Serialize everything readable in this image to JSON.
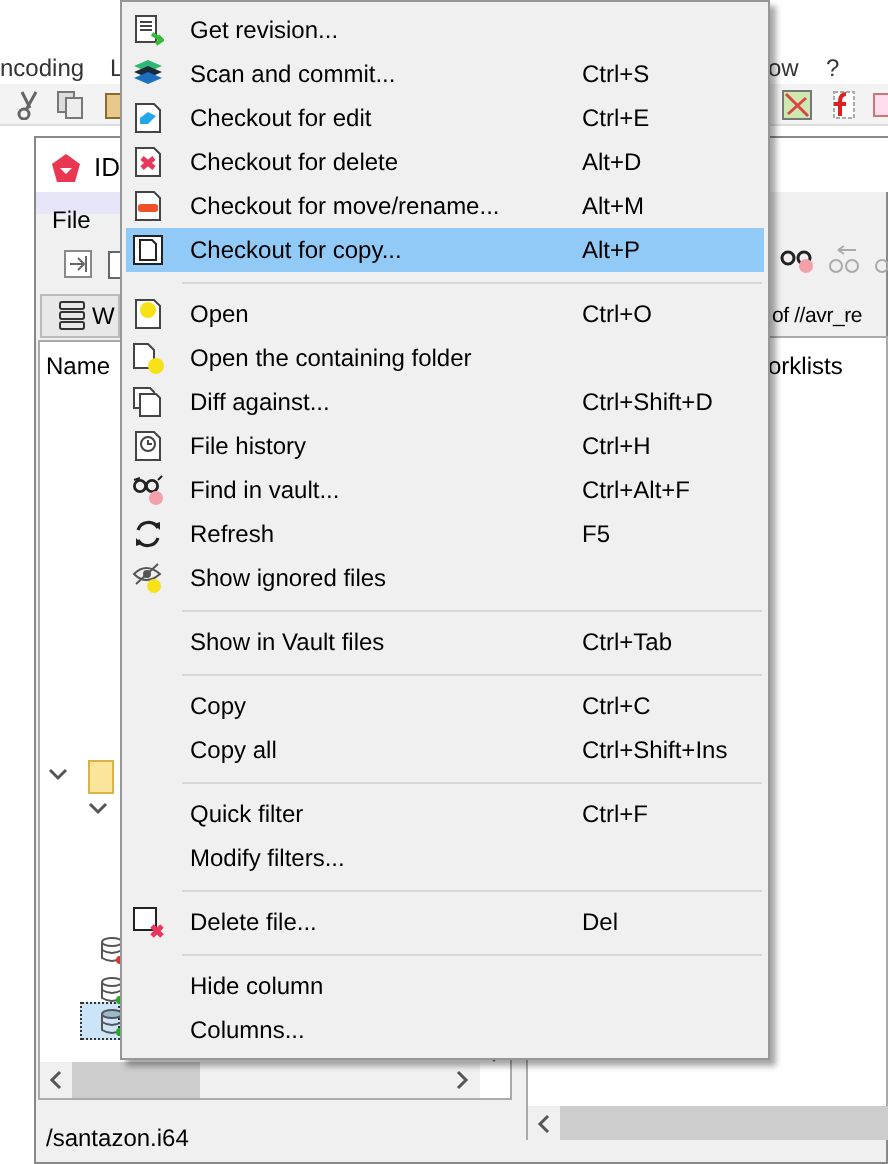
{
  "app_menu": [
    "ncoding",
    "L",
    "ow",
    "?"
  ],
  "window": {
    "title": "ID",
    "menu": [
      "File"
    ],
    "panel_button": "W",
    "panel_caption": "of //avr_re",
    "column_header": "Name",
    "right_column_header": "orklists",
    "path": "/santazon.i64"
  },
  "context_menu": [
    {
      "kind": "item",
      "label": "Get revision...",
      "selected": false
    },
    {
      "kind": "item",
      "label": "Scan and commit...",
      "shortcut": "Ctrl+S",
      "selected": false
    },
    {
      "kind": "item",
      "label": "Checkout for edit",
      "shortcut": "Ctrl+E",
      "selected": false
    },
    {
      "kind": "item",
      "label": "Checkout for delete",
      "shortcut": "Alt+D",
      "selected": false
    },
    {
      "kind": "item",
      "label": "Checkout for move/rename...",
      "shortcut": "Alt+M",
      "selected": false
    },
    {
      "kind": "item",
      "label": "Checkout for copy...",
      "shortcut": "Alt+P",
      "selected": true
    },
    {
      "kind": "separator"
    },
    {
      "kind": "item",
      "label": "Open",
      "shortcut": "Ctrl+O",
      "selected": false
    },
    {
      "kind": "item",
      "label": "Open the containing folder",
      "selected": false
    },
    {
      "kind": "item",
      "label": "Diff against...",
      "shortcut": "Ctrl+Shift+D",
      "selected": false
    },
    {
      "kind": "item",
      "label": "File history",
      "shortcut": "Ctrl+H",
      "selected": false
    },
    {
      "kind": "item",
      "label": "Find in vault...",
      "shortcut": "Ctrl+Alt+F",
      "selected": false
    },
    {
      "kind": "item",
      "label": "Refresh",
      "shortcut": "F5",
      "selected": false
    },
    {
      "kind": "item",
      "label": "Show ignored files",
      "selected": false
    },
    {
      "kind": "separator"
    },
    {
      "kind": "item",
      "label": "Show in Vault files",
      "shortcut": "Ctrl+Tab",
      "selected": false
    },
    {
      "kind": "separator"
    },
    {
      "kind": "item",
      "label": "Copy",
      "shortcut": "Ctrl+C",
      "selected": false
    },
    {
      "kind": "item",
      "label": "Copy all",
      "shortcut": "Ctrl+Shift+Ins",
      "selected": false
    },
    {
      "kind": "separator"
    },
    {
      "kind": "item",
      "label": "Quick filter",
      "shortcut": "Ctrl+F",
      "selected": false
    },
    {
      "kind": "item",
      "label": "Modify filters...",
      "selected": false
    },
    {
      "kind": "separator"
    },
    {
      "kind": "item",
      "label": "Delete file...",
      "shortcut": "Del",
      "selected": false
    },
    {
      "kind": "separator"
    },
    {
      "kind": "item",
      "label": "Hide column",
      "selected": false
    },
    {
      "kind": "item",
      "label": "Columns...",
      "selected": false
    }
  ]
}
